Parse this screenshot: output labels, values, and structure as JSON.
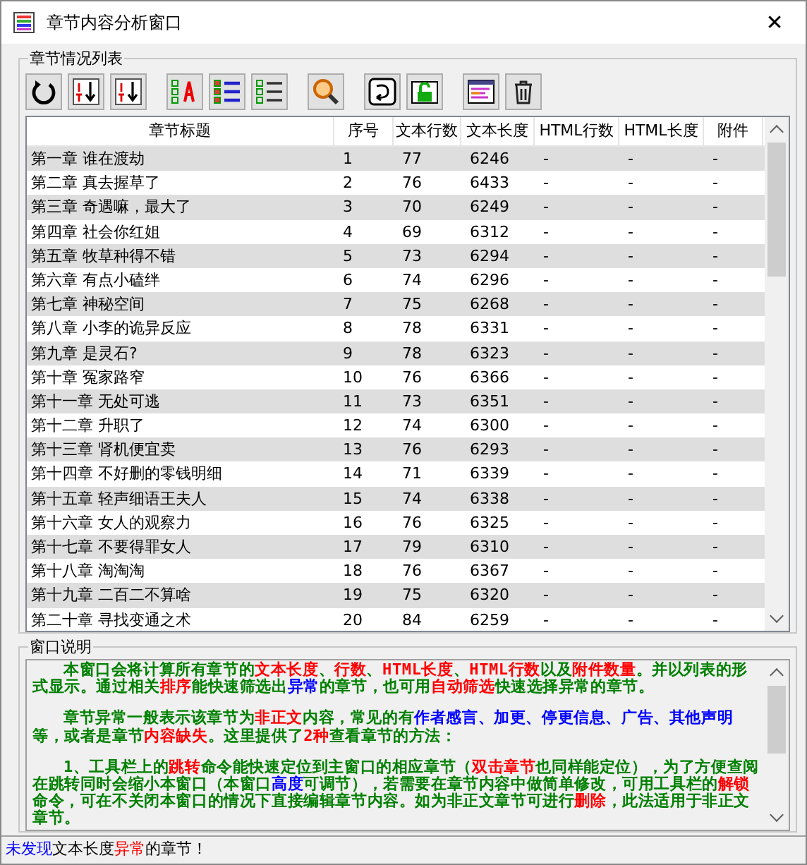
{
  "window": {
    "title": "章节内容分析窗口",
    "close": "✕"
  },
  "list_group": {
    "title": "章节情况列表"
  },
  "toolbar": [
    [
      {
        "kind": "refresh"
      },
      {
        "kind": "sort-asc"
      },
      {
        "kind": "sort-desc"
      }
    ],
    [
      {
        "kind": "auto-check"
      },
      {
        "kind": "checklist"
      },
      {
        "kind": "list"
      }
    ],
    [
      {
        "kind": "search"
      }
    ],
    [
      {
        "kind": "jump"
      },
      {
        "kind": "unlock"
      }
    ],
    [
      {
        "kind": "window"
      },
      {
        "kind": "trash"
      }
    ]
  ],
  "table": {
    "columns": [
      "章节标题",
      "序号",
      "文本行数",
      "文本长度",
      "HTML行数",
      "HTML长度",
      "附件"
    ],
    "rows": [
      [
        "第一章 谁在渡劫",
        "1",
        "77",
        "6246",
        "-",
        "-",
        "-"
      ],
      [
        "第二章 真去握草了",
        "2",
        "76",
        "6433",
        "-",
        "-",
        "-"
      ],
      [
        "第三章 奇遇嘛，最大了",
        "3",
        "70",
        "6249",
        "-",
        "-",
        "-"
      ],
      [
        "第四章 社会你红姐",
        "4",
        "69",
        "6312",
        "-",
        "-",
        "-"
      ],
      [
        "第五章 牧草种得不错",
        "5",
        "73",
        "6294",
        "-",
        "-",
        "-"
      ],
      [
        "第六章 有点小磕绊",
        "6",
        "74",
        "6296",
        "-",
        "-",
        "-"
      ],
      [
        "第七章 神秘空间",
        "7",
        "75",
        "6268",
        "-",
        "-",
        "-"
      ],
      [
        "第八章 小李的诡异反应",
        "8",
        "78",
        "6331",
        "-",
        "-",
        "-"
      ],
      [
        "第九章 是灵石?",
        "9",
        "78",
        "6323",
        "-",
        "-",
        "-"
      ],
      [
        "第十章 冤家路窄",
        "10",
        "76",
        "6366",
        "-",
        "-",
        "-"
      ],
      [
        "第十一章 无处可逃",
        "11",
        "73",
        "6351",
        "-",
        "-",
        "-"
      ],
      [
        "第十二章 升职了",
        "12",
        "74",
        "6300",
        "-",
        "-",
        "-"
      ],
      [
        "第十三章 肾机便宜卖",
        "13",
        "76",
        "6293",
        "-",
        "-",
        "-"
      ],
      [
        "第十四章 不好删的零钱明细",
        "14",
        "71",
        "6339",
        "-",
        "-",
        "-"
      ],
      [
        "第十五章 轻声细语王夫人",
        "15",
        "74",
        "6338",
        "-",
        "-",
        "-"
      ],
      [
        "第十六章 女人的观察力",
        "16",
        "76",
        "6325",
        "-",
        "-",
        "-"
      ],
      [
        "第十七章 不要得罪女人",
        "17",
        "79",
        "6310",
        "-",
        "-",
        "-"
      ],
      [
        "第十八章 淘淘淘",
        "18",
        "76",
        "6367",
        "-",
        "-",
        "-"
      ],
      [
        "第十九章 二百二不算啥",
        "19",
        "75",
        "6320",
        "-",
        "-",
        "-"
      ],
      [
        "第二十章 寻找变通之术",
        "20",
        "84",
        "6259",
        "-",
        "-",
        "-"
      ]
    ]
  },
  "description": {
    "title": "窗口说明",
    "paragraphs": [
      [
        {
          "text": "本窗口会将计算所有章节的",
          "color": "#008000"
        },
        {
          "text": "文本长度",
          "color": "#ff0000"
        },
        {
          "text": "、",
          "color": "#008000"
        },
        {
          "text": "行数",
          "color": "#ff0000"
        },
        {
          "text": "、",
          "color": "#008000"
        },
        {
          "text": "HTML长度",
          "color": "#ff0000"
        },
        {
          "text": "、",
          "color": "#008000"
        },
        {
          "text": "HTML行数",
          "color": "#ff0000"
        },
        {
          "text": "以及",
          "color": "#008000"
        },
        {
          "text": "附件数量",
          "color": "#ff0000"
        },
        {
          "text": "。并以列表的形式显示。通过相关",
          "color": "#008000"
        },
        {
          "text": "排序",
          "color": "#ff0000"
        },
        {
          "text": "能快速筛选出",
          "color": "#008000"
        },
        {
          "text": "异常",
          "color": "#0000ff"
        },
        {
          "text": "的章节，也可用",
          "color": "#008000"
        },
        {
          "text": "自动筛选",
          "color": "#ff0000"
        },
        {
          "text": "快速选择异常的章节。",
          "color": "#008000"
        }
      ],
      [
        {
          "text": "章节异常一般表示该章节为",
          "color": "#008000"
        },
        {
          "text": "非正文",
          "color": "#ff0000"
        },
        {
          "text": "内容，常见的有",
          "color": "#008000"
        },
        {
          "text": "作者感言、加更、停更信息、广告、其他声明",
          "color": "#0000ff"
        },
        {
          "text": "等，或者是章节",
          "color": "#008000"
        },
        {
          "text": "内容缺失",
          "color": "#ff0000"
        },
        {
          "text": "。这里提供了",
          "color": "#008000"
        },
        {
          "text": "2种",
          "color": "#ff0000"
        },
        {
          "text": "查看章节的方法：",
          "color": "#008000"
        }
      ],
      [
        {
          "text": "1、工具栏上的",
          "color": "#008000"
        },
        {
          "text": "跳转",
          "color": "#ff0000"
        },
        {
          "text": "命令能快速定位到主窗口的相应章节（",
          "color": "#008000"
        },
        {
          "text": "双击章节",
          "color": "#ff0000"
        },
        {
          "text": "也同样能定位），为了方便查阅在跳转同时会缩小本窗口（本窗口",
          "color": "#008000"
        },
        {
          "text": "高度",
          "color": "#0000ff"
        },
        {
          "text": "可调节），若需要在章节内容中做简单修改，可用工具栏的",
          "color": "#008000"
        },
        {
          "text": "解锁",
          "color": "#ff0000"
        },
        {
          "text": "命令，可在不关闭本窗口的情况下直接编辑章节内容。如为非正文章节可进行",
          "color": "#008000"
        },
        {
          "text": "删除",
          "color": "#ff0000"
        },
        {
          "text": "，此法适用于非正文章节。",
          "color": "#008000"
        }
      ]
    ]
  },
  "status_bar": [
    {
      "text": "未发现",
      "color": "#0000ff"
    },
    {
      "text": "文本长度",
      "color": "#000000"
    },
    {
      "text": "异常",
      "color": "#ff0000"
    },
    {
      "text": "的章节！",
      "color": "#000000"
    }
  ]
}
